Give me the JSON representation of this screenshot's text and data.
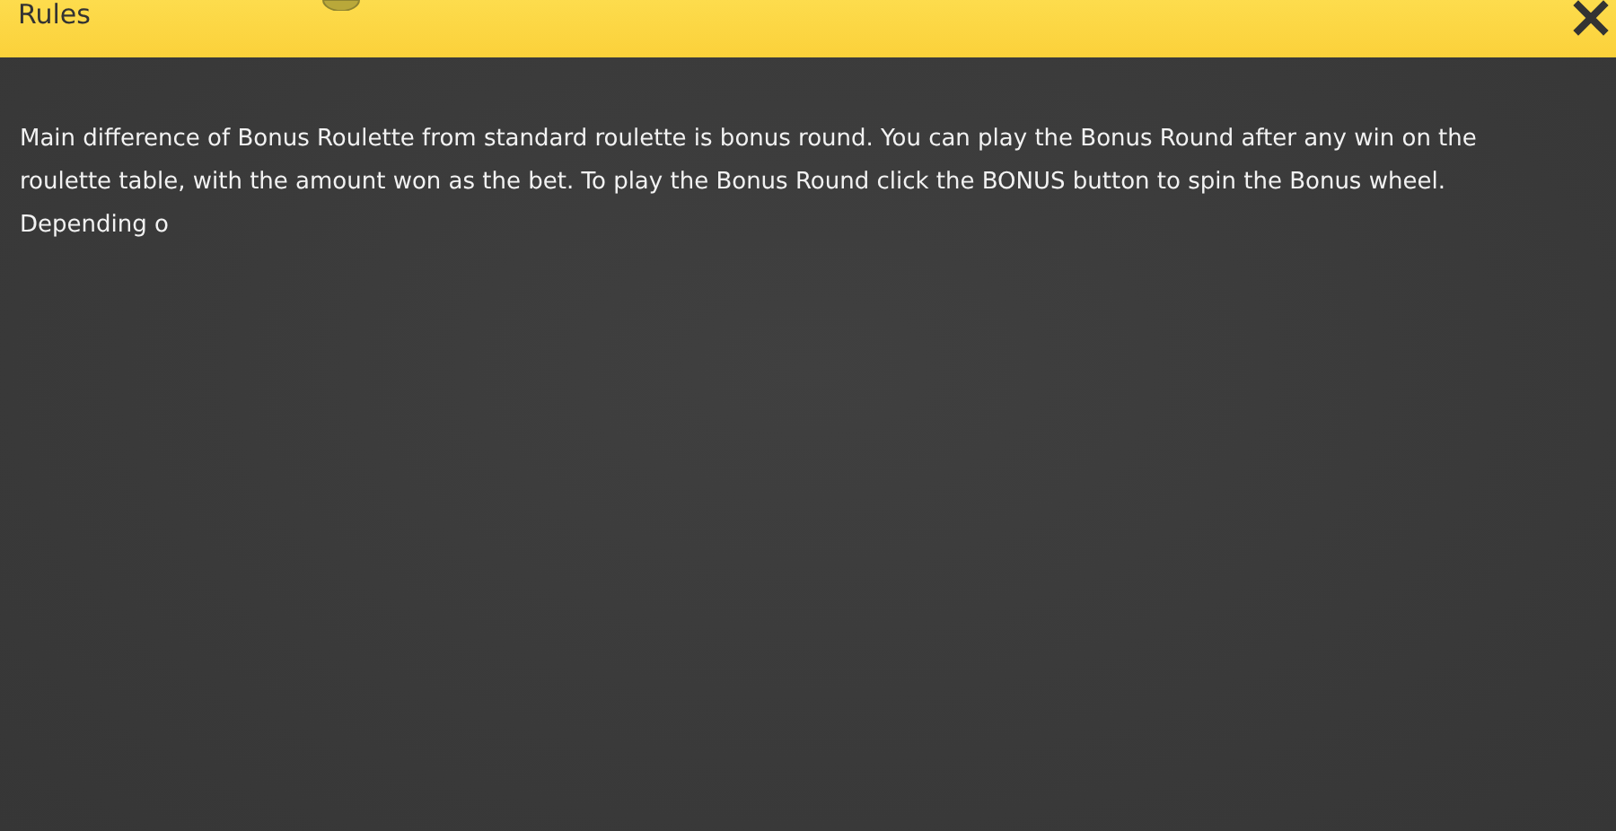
{
  "header": {
    "title": "Rules"
  },
  "rules_text": [
    "Main difference of Bonus Roulette from standard roulette is bonus round. You can play the Bonus Round after any win on the",
    "roulette table, with the amount won as the bet. To play the Bonus Round click the BONUS button to spin the Bonus wheel.",
    "Depending o"
  ]
}
